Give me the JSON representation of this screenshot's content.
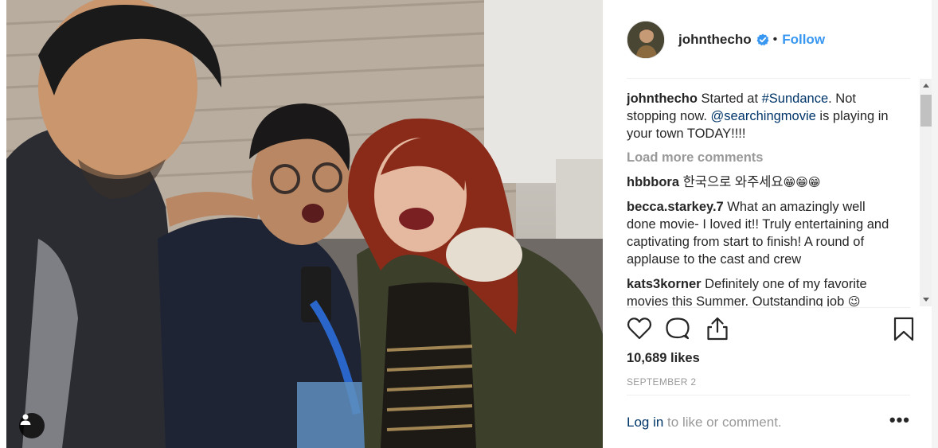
{
  "post": {
    "photo_alt": "Selfie of three people",
    "tagged_icon": "person-tag-icon"
  },
  "header": {
    "username": "johnthecho",
    "verified_icon": "verified-badge-icon",
    "separator": "•",
    "follow_label": "Follow"
  },
  "caption": {
    "username": "johnthecho",
    "text_1": " Started at ",
    "hashtag": "#Sundance",
    "text_2": ". Not stopping now. ",
    "mention": "@searchingmovie",
    "text_3": " is playing in your town TODAY!!!!"
  },
  "load_more_label": "Load more comments",
  "comments": [
    {
      "username": "hbbbora",
      "text": " 한국으로 와주세요",
      "emoji": "😁😁😁"
    },
    {
      "username": "becca.starkey.7",
      "text": " What an amazingly well done movie- I loved it!! Truly entertaining and captivating from start to finish! A round of applause to the cast and crew",
      "emoji": ""
    },
    {
      "username": "kats3korner",
      "text": " Definitely one of my favorite movies this Summer. Outstanding job ",
      "emoji": "😉"
    }
  ],
  "actions": {
    "like_icon": "heart-icon",
    "comment_icon": "comment-bubble-icon",
    "share_icon": "share-icon",
    "save_icon": "bookmark-icon"
  },
  "likes_label": "10,689 likes",
  "date_label": "SEPTEMBER 2",
  "footer": {
    "login_label": "Log in",
    "rest_label": " to like or comment.",
    "more_label": "•••"
  },
  "colors": {
    "link_blue": "#3897f0",
    "dark_link": "#003569",
    "muted": "#999999",
    "text": "#262626",
    "verified_blue": "#3897f0"
  }
}
